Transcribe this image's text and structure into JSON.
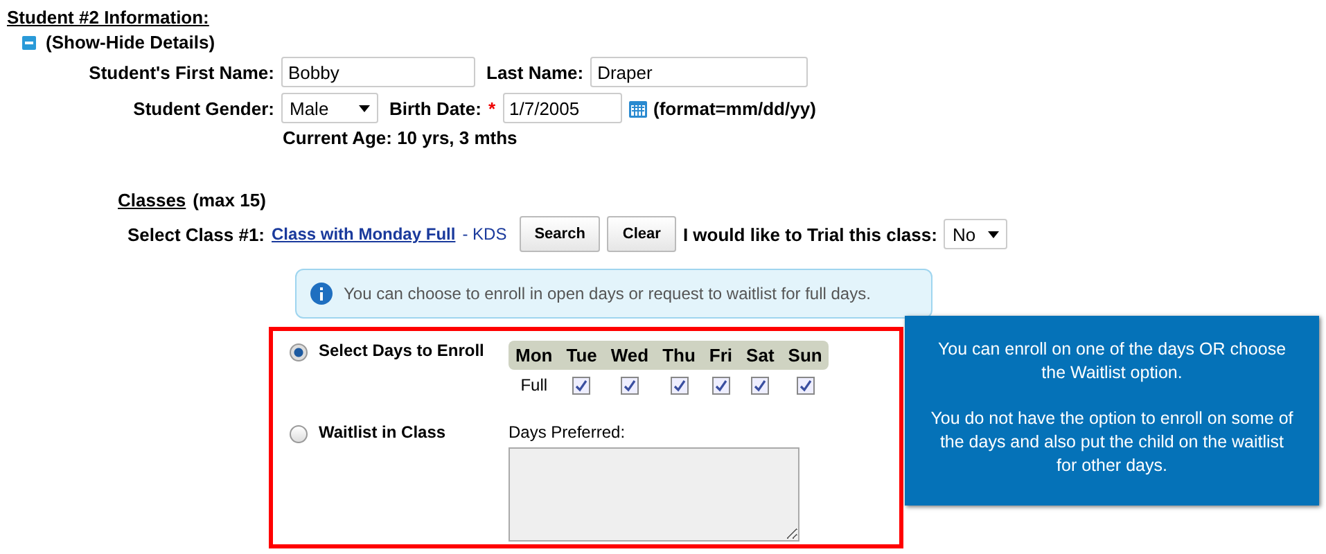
{
  "heading": "Student #2 Information:",
  "toggle": {
    "label": "(Show-Hide Details)",
    "expanded": true
  },
  "first_name": {
    "label": "Student's First Name:",
    "value": "Bobby"
  },
  "last_name": {
    "label": "Last Name:",
    "value": "Draper"
  },
  "gender": {
    "label": "Student Gender:",
    "value": "Male"
  },
  "birth_date": {
    "label": "Birth Date:",
    "required_mark": "*",
    "value": "1/7/2005",
    "format": "(format=mm/dd/yy)"
  },
  "current_age": "Current Age: 10 yrs, 3 mths",
  "classes": {
    "title": "Classes",
    "note": "(max 15)"
  },
  "select_class": {
    "label": "Select Class #1:",
    "link": "Class with Monday Full",
    "suffix": "- KDS",
    "buttons": [
      "Search",
      "Clear"
    ],
    "trial_label": "I would like to Trial this class:",
    "trial_value": "No"
  },
  "info": "You can choose to enroll in open days or request to waitlist for full days.",
  "options": [
    {
      "label": "Select Days to Enroll",
      "selected": true
    },
    {
      "label": "Waitlist in Class",
      "selected": false
    }
  ],
  "days": [
    {
      "label": "Mon",
      "kind": "status",
      "status": "Full"
    },
    {
      "label": "Tue",
      "kind": "checkbox",
      "checked": true
    },
    {
      "label": "Wed",
      "kind": "checkbox",
      "checked": true
    },
    {
      "label": "Thu",
      "kind": "checkbox",
      "checked": true
    },
    {
      "label": "Fri",
      "kind": "checkbox",
      "checked": true
    },
    {
      "label": "Sat",
      "kind": "checkbox",
      "checked": true
    },
    {
      "label": "Sun",
      "kind": "checkbox",
      "checked": true
    }
  ],
  "days_preferred": {
    "label": "Days Preferred:"
  },
  "callout": [
    "You can enroll on one of the days OR choose the Waitlist option.",
    "You do not have the option to enroll on some of the days and also put the child on the waitlist for other days."
  ]
}
